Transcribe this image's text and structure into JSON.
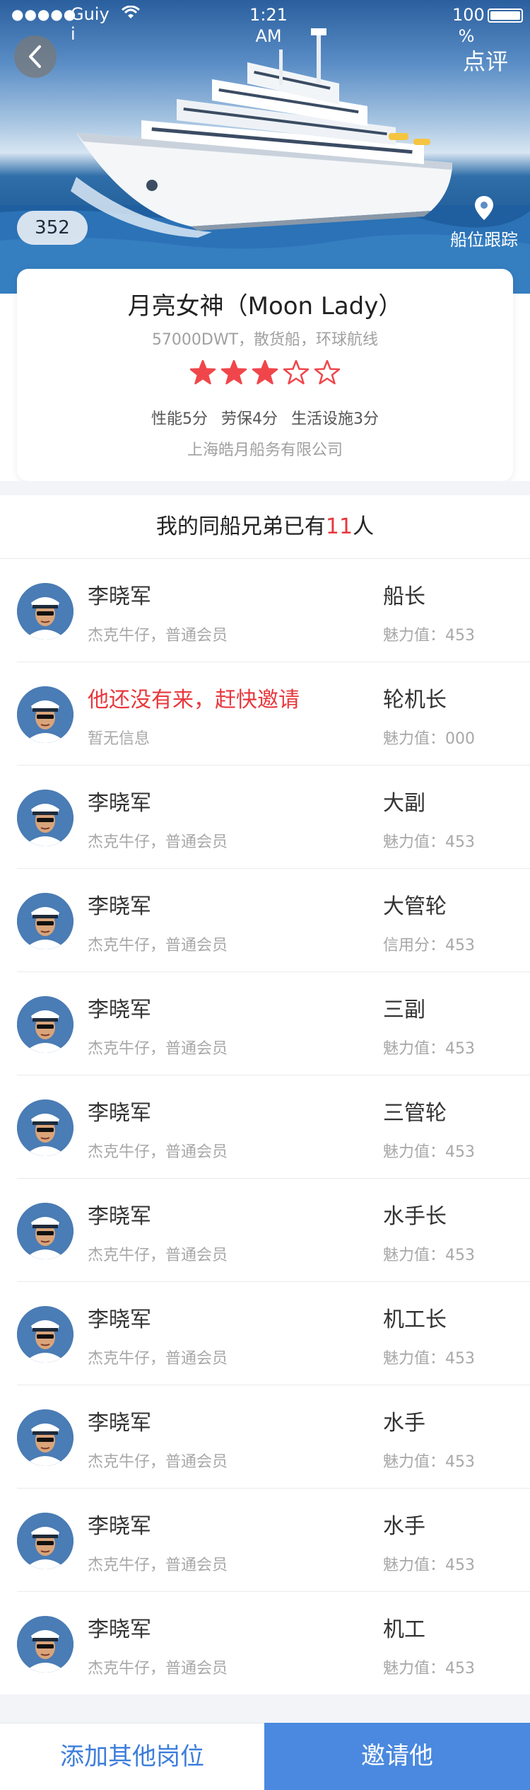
{
  "status_bar": {
    "signal_dots": "●●●●●",
    "carrier": "Guiyi",
    "time": "1:21 AM",
    "battery": "100 %"
  },
  "hero": {
    "review_label": "点评",
    "count_badge": "352",
    "track_label": "船位跟踪"
  },
  "ship": {
    "name": "月亮女神（Moon Lady）",
    "subtitle": "57000DWT，散货船，环球航线",
    "rating": 3,
    "rating_max": 5,
    "scores": [
      "性能5分",
      "劳保4分",
      "生活设施3分"
    ],
    "company": "上海皓月船务有限公司"
  },
  "crew_header": {
    "prefix": "我的同船兄弟已有",
    "count": "11",
    "suffix": "人"
  },
  "crew": [
    {
      "name": "李晓军",
      "member": "杰克牛仔，普通会员",
      "role": "船长",
      "metric": "魅力值：453",
      "invite": false
    },
    {
      "name": "他还没有来，赶快邀请",
      "member": "暂无信息",
      "role": "轮机长",
      "metric": "魅力值：000",
      "invite": true
    },
    {
      "name": "李晓军",
      "member": "杰克牛仔，普通会员",
      "role": "大副",
      "metric": "魅力值：453",
      "invite": false
    },
    {
      "name": "李晓军",
      "member": "杰克牛仔，普通会员",
      "role": "大管轮",
      "metric": "信用分：453",
      "invite": false
    },
    {
      "name": "李晓军",
      "member": "杰克牛仔，普通会员",
      "role": "三副",
      "metric": "魅力值：453",
      "invite": false
    },
    {
      "name": "李晓军",
      "member": "杰克牛仔，普通会员",
      "role": "三管轮",
      "metric": "魅力值：453",
      "invite": false
    },
    {
      "name": "李晓军",
      "member": "杰克牛仔，普通会员",
      "role": "水手长",
      "metric": "魅力值：453",
      "invite": false
    },
    {
      "name": "李晓军",
      "member": "杰克牛仔，普通会员",
      "role": "机工长",
      "metric": "魅力值：453",
      "invite": false
    },
    {
      "name": "李晓军",
      "member": "杰克牛仔，普通会员",
      "role": "水手",
      "metric": "魅力值：453",
      "invite": false
    },
    {
      "name": "李晓军",
      "member": "杰克牛仔，普通会员",
      "role": "水手",
      "metric": "魅力值：453",
      "invite": false
    },
    {
      "name": "李晓军",
      "member": "杰克牛仔，普通会员",
      "role": "机工",
      "metric": "魅力值：453",
      "invite": false
    }
  ],
  "bottom_bar": {
    "add_label": "添加其他岗位",
    "invite_label": "邀请他"
  },
  "colors": {
    "accent_blue": "#4a89df",
    "alert_red": "#e8383d",
    "star_red": "#f0464b"
  }
}
